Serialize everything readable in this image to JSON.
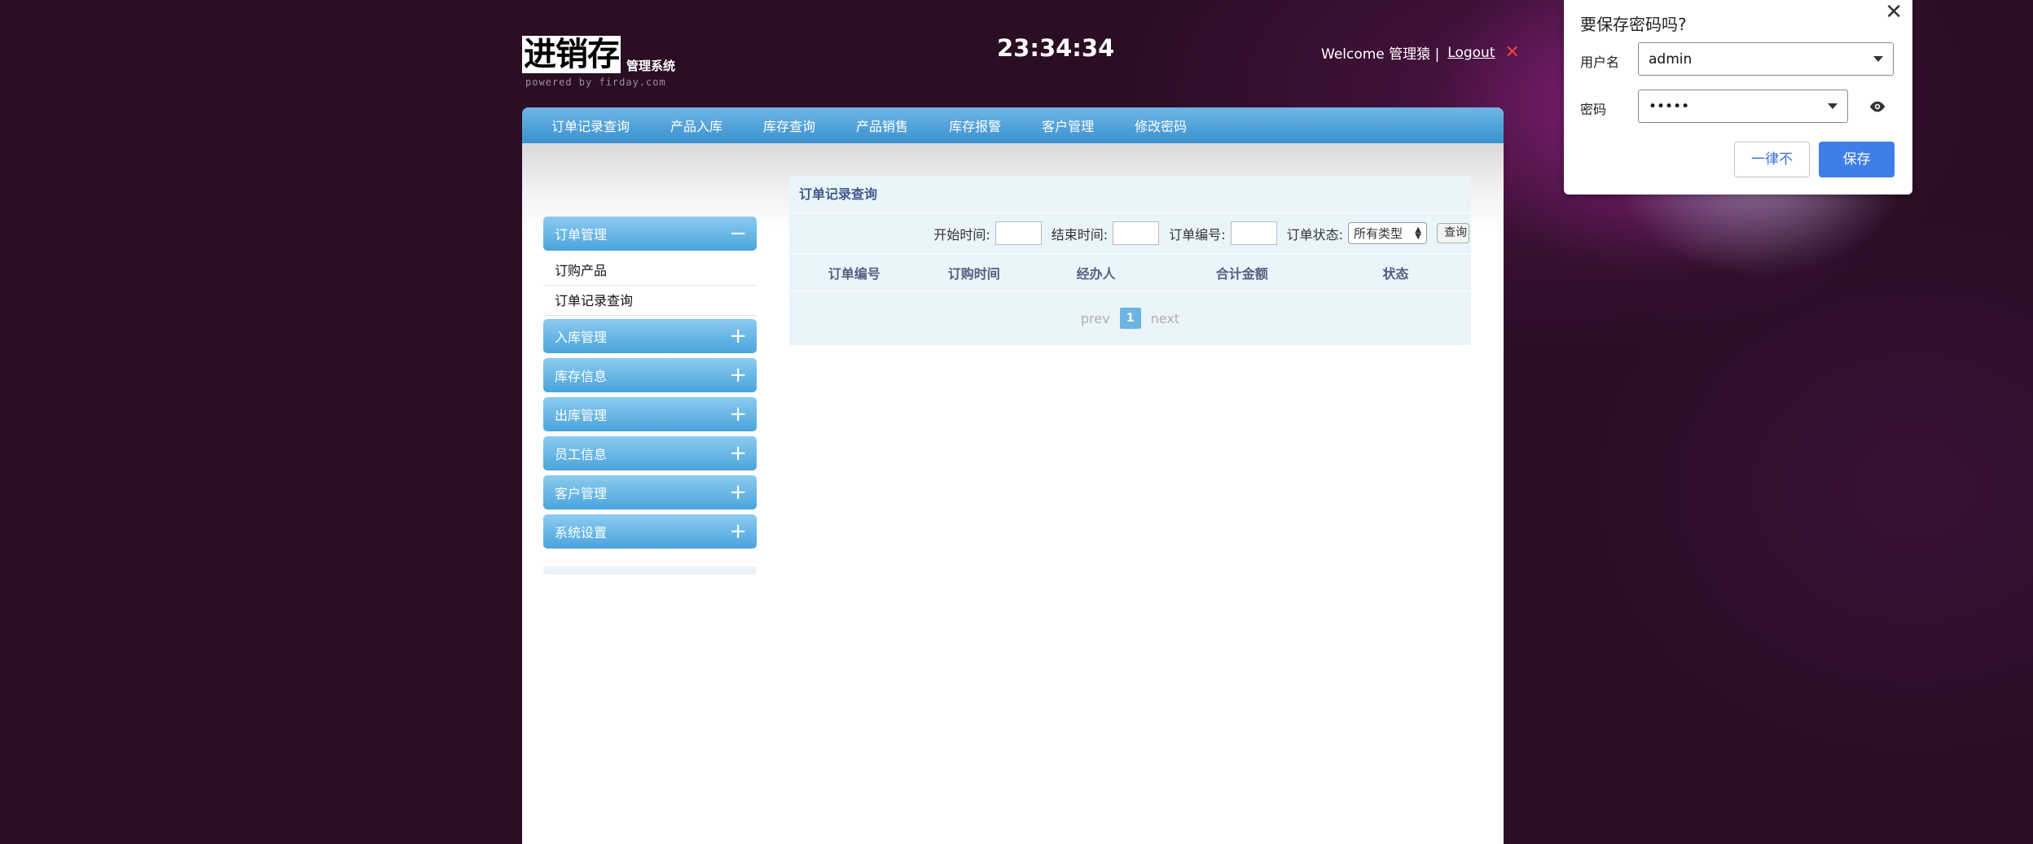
{
  "header": {
    "logo_main": "进销存",
    "logo_sub": "管理系统",
    "logo_powered": "powered  by  firday.com",
    "clock": "23:34:34",
    "welcome": "Welcome 管理猿 |",
    "logout": "Logout"
  },
  "topnav": [
    "订单记录查询",
    "产品入库",
    "库存查询",
    "产品销售",
    "库存报警",
    "客户管理",
    "修改密码"
  ],
  "sidebar": {
    "expanded": {
      "label": "订单管理",
      "sign": "−",
      "items": [
        "订购产品",
        "订单记录查询"
      ]
    },
    "collapsed": [
      "入库管理",
      "库存信息",
      "出库管理",
      "员工信息",
      "客户管理",
      "系统设置"
    ],
    "collapsed_sign": "+"
  },
  "panel": {
    "title": "订单记录查询",
    "filters": {
      "start_label": "开始时间:",
      "end_label": "结束时间:",
      "order_no_label": "订单编号:",
      "status_label": "订单状态:",
      "status_value": "所有类型",
      "query_button": "查询"
    },
    "columns": [
      "订单编号",
      "订购时间",
      "经办人",
      "合计金额",
      "状态"
    ],
    "pager": {
      "prev": "prev",
      "current": "1",
      "next": "next"
    }
  },
  "password_dialog": {
    "title": "要保存密码吗?",
    "username_label": "用户名",
    "username_value": "admin",
    "password_label": "密码",
    "password_value": "•••••",
    "never_button": "一律不",
    "save_button": "保存"
  },
  "colors": {
    "nav_blue": "#4aa4dc",
    "panel_bg": "#eaf4fb",
    "save_blue": "#3f7ee8",
    "logout_x": "#e8443a"
  }
}
